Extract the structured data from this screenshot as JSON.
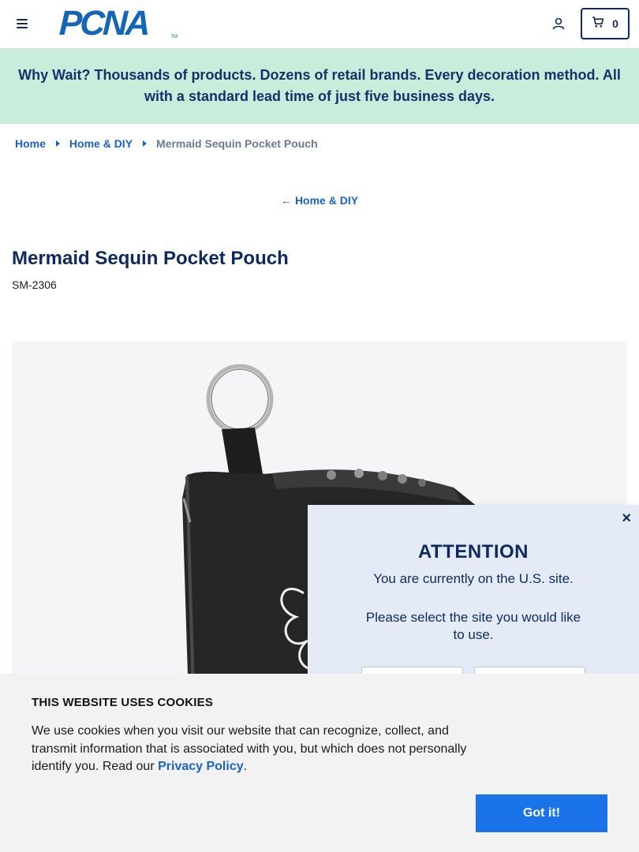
{
  "header": {
    "logo_text": "PCNA",
    "logo_tm": "TM",
    "cart_count": "0"
  },
  "promo": {
    "text": "Why Wait? Thousands of products. Dozens of retail brands. Every decoration method. All with a standard lead time of just five business days."
  },
  "breadcrumb": {
    "items": [
      "Home",
      "Home & DIY"
    ],
    "current": "Mermaid Sequin Pocket Pouch"
  },
  "back_link": {
    "arrow": "←",
    "label": "Home & DIY"
  },
  "product": {
    "title": "Mermaid Sequin Pocket Pouch",
    "sku": "SM-2306"
  },
  "attention": {
    "close": "×",
    "title": "ATTENTION",
    "line1": "You are currently on the U.S. site.",
    "line2": "Please select the site you would like to use."
  },
  "cookie": {
    "title": "THIS WEBSITE USES COOKIES",
    "text": "We use cookies when you visit our website that can recognize, collect, and transmit information that is associated with you, but which does not personally identify you. Read our ",
    "link": "Privacy Policy",
    "text_end": ".",
    "button": "Got it!"
  },
  "colors": {
    "brand_blue": "#1565b5",
    "navy": "#0e2a5c",
    "link_blue": "#1a62c6",
    "promo_bg": "#c8eedb",
    "cookie_button": "#1a73e8",
    "modal_bg": "#e4ebf7"
  },
  "icons": {
    "menu": "hamburger-icon",
    "account": "user-icon",
    "cart": "cart-icon",
    "back": "arrow-left-icon",
    "close": "close-icon"
  }
}
